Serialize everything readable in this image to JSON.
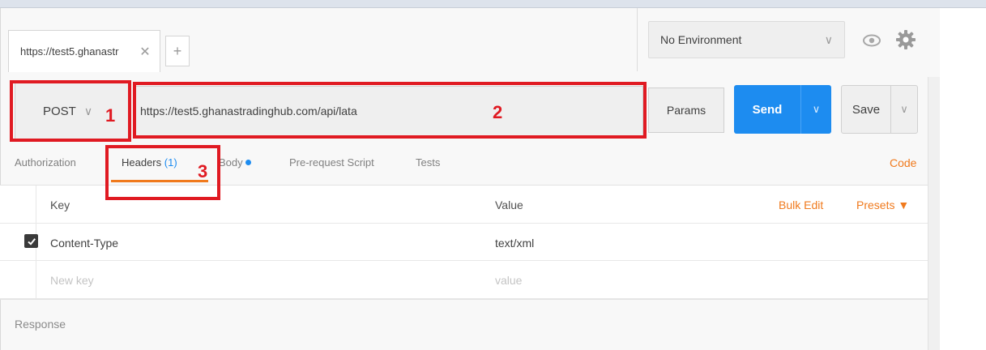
{
  "tabs": [
    {
      "title": "https://test5.ghanastr",
      "close": "✕"
    }
  ],
  "new_tab_label": "+",
  "environment": {
    "selected": "No Environment",
    "chevron": "∨"
  },
  "request": {
    "method": "POST",
    "method_chevron": "∨",
    "url": "https://test5.ghanastradinghub.com/api/lata",
    "params_label": "Params",
    "send_label": "Send",
    "send_chevron": "∨",
    "save_label": "Save",
    "save_chevron": "∨"
  },
  "annotations": [
    "1",
    "2",
    "3"
  ],
  "subtabs": {
    "authorization": "Authorization",
    "headers": "Headers",
    "headers_count": "(1)",
    "body": "Body",
    "pre_request": "Pre-request Script",
    "tests": "Tests",
    "code": "Code"
  },
  "headers_table": {
    "key_header": "Key",
    "value_header": "Value",
    "bulk_edit": "Bulk Edit",
    "presets": "Presets ▼",
    "rows": [
      {
        "key": "Content-Type",
        "value": "text/xml",
        "checked": true
      }
    ],
    "new_key_placeholder": "New key",
    "new_value_placeholder": "value"
  },
  "response_label": "Response",
  "colors": {
    "accent_blue": "#1d8cf0",
    "accent_orange": "#f07a1d",
    "annotation_red": "#e01a22"
  }
}
